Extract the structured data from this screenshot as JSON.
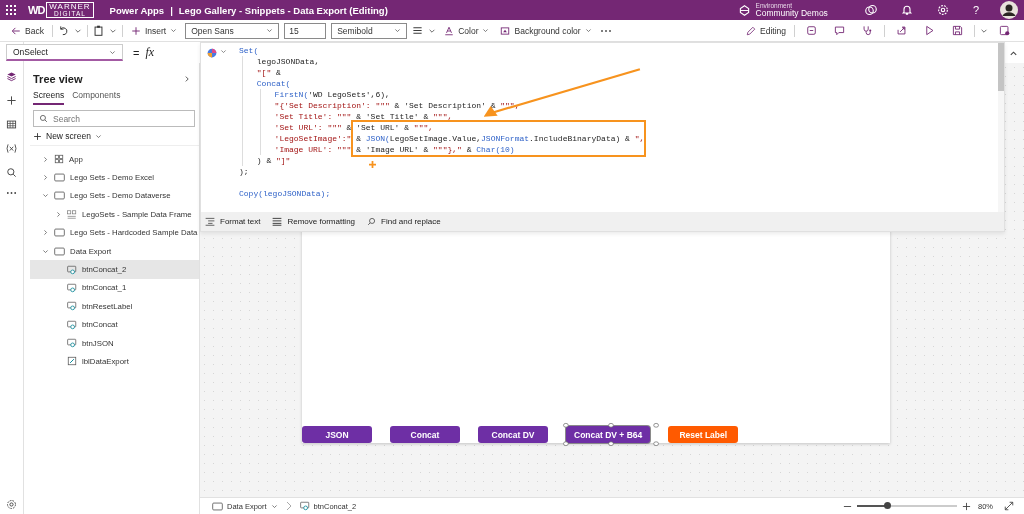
{
  "header": {
    "logo": {
      "mark": "WD",
      "name": "WARNER",
      "sub": "DIGITAL"
    },
    "app": "Power Apps",
    "separator": "|",
    "title": "Lego Gallery - Snippets - Data Export (Editing)",
    "environment": {
      "label": "Environment",
      "name": "Community Demos"
    },
    "help": "?"
  },
  "toolbar": {
    "back": "Back",
    "insert": "Insert",
    "font": "Open Sans",
    "size": "15",
    "weight": "Semibold",
    "color_label": "Color",
    "background_color": "Background color",
    "mode": "Editing"
  },
  "formula_bar": {
    "property": "OnSelect",
    "equals": "=",
    "fx": "fx"
  },
  "tree_view": {
    "title": "Tree view",
    "tabs": [
      {
        "label": "Screens",
        "selected": true
      },
      {
        "label": "Components",
        "selected": false
      }
    ],
    "search": {
      "placeholder": "Search"
    },
    "new_screen": "New screen",
    "items": [
      {
        "label": "App",
        "kind": "app",
        "expanded": false,
        "selected": false
      },
      {
        "label": "Lego Sets - Demo Excel",
        "kind": "screen",
        "expanded": false,
        "selected": false
      },
      {
        "label": "Lego Sets - Demo Dataverse",
        "kind": "screen",
        "expanded": true,
        "selected": false,
        "children": [
          {
            "label": "LegoSets - Sample Data Frame",
            "kind": "gallery",
            "expanded": false,
            "selected": false
          }
        ]
      },
      {
        "label": "Lego Sets - Hardcoded Sample Data",
        "kind": "screen",
        "expanded": false,
        "selected": false
      },
      {
        "label": "Data Export",
        "kind": "screen",
        "expanded": true,
        "selected": false,
        "children": [
          {
            "label": "btnConcat_2",
            "kind": "button",
            "selected": true
          },
          {
            "label": "btnConcat_1",
            "kind": "button",
            "selected": false
          },
          {
            "label": "btnResetLabel",
            "kind": "button",
            "selected": false
          },
          {
            "label": "btnConcat",
            "kind": "button",
            "selected": false
          },
          {
            "label": "btnJSON",
            "kind": "button",
            "selected": false
          },
          {
            "label": "lblDataExport",
            "kind": "label",
            "selected": false
          }
        ]
      }
    ]
  },
  "editor": {
    "statements": [
      {
        "segments": [
          {
            "kind": "fn",
            "text": "Set("
          }
        ],
        "children": [
          {
            "segments": [
              {
                "kind": "plain",
                "text": "legoJSONData,"
              }
            ]
          },
          {
            "segments": [
              {
                "kind": "str",
                "text": "\"[\""
              },
              {
                "kind": "plain",
                "text": " &"
              }
            ]
          },
          {
            "segments": [
              {
                "kind": "fn",
                "text": "Concat("
              }
            ],
            "children": [
              {
                "segments": [
                  {
                    "kind": "fn",
                    "text": "FirstN("
                  },
                  {
                    "kind": "plain",
                    "text": "'WD LegoSets',6),"
                  }
                ]
              },
              {
                "segments": [
                  {
                    "kind": "str",
                    "text": "\"{'Set Description': \"\"\""
                  },
                  {
                    "kind": "plain",
                    "text": " & 'Set Description' & "
                  },
                  {
                    "kind": "str",
                    "text": "\"\"\","
                  }
                ]
              },
              {
                "segments": [
                  {
                    "kind": "str",
                    "text": "'Set Title': \"\"\""
                  },
                  {
                    "kind": "plain",
                    "text": " & 'Set Title' & "
                  },
                  {
                    "kind": "str",
                    "text": "\"\"\","
                  }
                ]
              },
              {
                "segments": [
                  {
                    "kind": "str",
                    "text": "'Set URL': \"\"\""
                  },
                  {
                    "kind": "plain",
                    "text": " & 'Set URL' & "
                  },
                  {
                    "kind": "str",
                    "text": "\"\"\","
                  }
                ]
              },
              {
                "segments": [
                  {
                    "kind": "str",
                    "text": "'LegoSetImage':\""
                  },
                  {
                    "kind": "plain",
                    "text": " & "
                  },
                  {
                    "kind": "fn",
                    "text": "JSON("
                  },
                  {
                    "kind": "plain",
                    "text": "LegoSetImage.Value,"
                  },
                  {
                    "kind": "fn",
                    "text": "JSONFormat"
                  },
                  {
                    "kind": "plain",
                    "text": ".IncludeBinaryData) & "
                  },
                  {
                    "kind": "str",
                    "text": "\","
                  }
                ]
              },
              {
                "segments": [
                  {
                    "kind": "str",
                    "text": "'Image URL': \"\"\""
                  },
                  {
                    "kind": "plain",
                    "text": " & 'Image URL' & "
                  },
                  {
                    "kind": "str",
                    "text": "\"\"\"},\""
                  },
                  {
                    "kind": "plain",
                    "text": " & "
                  },
                  {
                    "kind": "fn",
                    "text": "Char(10)"
                  }
                ]
              }
            ]
          },
          {
            "segments": [
              {
                "kind": "plain",
                "text": ") & "
              },
              {
                "kind": "str",
                "text": "\"]\""
              }
            ]
          }
        ],
        "closing": {
          "segments": [
            {
              "kind": "plain",
              "text": ");"
            }
          ]
        }
      },
      {
        "segments": [
          {
            "kind": "fn",
            "text": "Copy(legoJSONData);"
          }
        ]
      }
    ],
    "tools": [
      {
        "kind": "format",
        "label": "Format text"
      },
      {
        "kind": "clear",
        "label": "Remove formatting"
      },
      {
        "kind": "find",
        "label": "Find and replace"
      }
    ]
  },
  "canvas": {
    "buttons": [
      {
        "label": "JSON",
        "color": "#6e2fa5",
        "selected": false
      },
      {
        "label": "Concat",
        "color": "#6e2fa5",
        "selected": false
      },
      {
        "label": "Concat DV",
        "color": "#6e2fa5",
        "selected": false
      },
      {
        "label": "Concat DV + B64",
        "color": "#6e2fa5",
        "selected": true
      },
      {
        "label": "Reset Label",
        "color": "#ff5a00",
        "selected": false
      }
    ]
  },
  "status_bar": {
    "screen": "Data Export",
    "control": "btnConcat_2",
    "zoom": {
      "level": 0.3,
      "reading": "80%"
    }
  }
}
